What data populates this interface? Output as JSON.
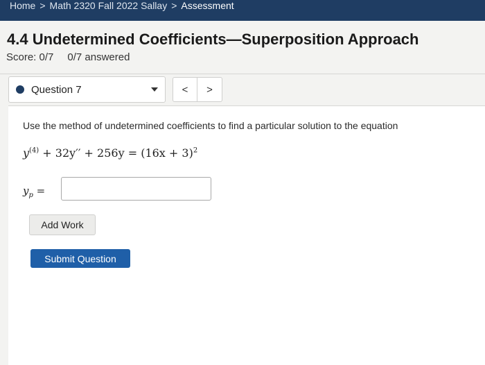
{
  "breadcrumb": {
    "items": [
      "Home",
      "Math 2320 Fall 2022 Sallay",
      "Assessment"
    ],
    "separator": ">"
  },
  "header": {
    "title": "4.4 Undetermined Coefficients—Superposition Approach",
    "score": "Score: 0/7",
    "answered": "0/7 answered"
  },
  "question_nav": {
    "selected": "Question 7",
    "prev_label": "<",
    "next_label": ">"
  },
  "question": {
    "prompt": "Use the method of undetermined coefficients to find a particular solution to the equation",
    "equation": {
      "y_base": "y",
      "order": "(4)",
      "mid": " + 32y′′ + 256y = (16x + 3)",
      "exponent": "2"
    },
    "answer_label_base": "y",
    "answer_label_sub": "p",
    "answer_label_eq": " =",
    "answer_value": ""
  },
  "buttons": {
    "add_work": "Add Work",
    "submit": "Submit Question"
  },
  "colors": {
    "header_bg": "#1f3d63",
    "submit_bg": "#1f5fa8"
  }
}
